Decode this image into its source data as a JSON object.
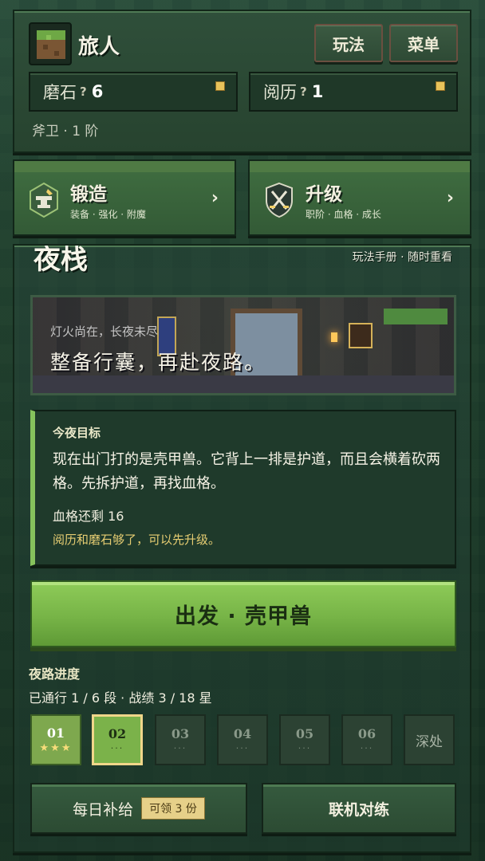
{
  "header": {
    "player_name": "旅人",
    "rules_label": "玩法",
    "menu_label": "菜单",
    "stone": {
      "label": "磨石",
      "hint": "?",
      "value": "6"
    },
    "experience": {
      "label": "阅历",
      "hint": "?",
      "value": "1"
    },
    "rank": "斧卫 · 1 阶"
  },
  "cards": [
    {
      "title": "锻造",
      "subtitle": "装备 · 强化 · 附魔",
      "icon": "anvil-icon"
    },
    {
      "title": "升级",
      "subtitle": "职阶 · 血格 · 成长",
      "icon": "crossed-swords-shield-icon"
    }
  ],
  "main": {
    "title": "夜栈",
    "manual_link": "玩法手册 · 随时重看",
    "banner": {
      "subtitle": "灯火尚在，长夜未尽",
      "headline": "整备行囊，再赴夜路。"
    },
    "objective": {
      "heading": "今夜目标",
      "text": "现在出门打的是壳甲兽。它背上一排是护道，而且会横着砍两格。先拆护道，再找血格。",
      "hp": "血格还剩 16",
      "tip": "阅历和磨石够了，可以先升级。"
    },
    "go_button": "出发 · 壳甲兽",
    "progress": {
      "title": "夜路进度",
      "stats": "已通行 1 / 6 段 · 战绩 3 / 18 星",
      "stages": [
        {
          "num": "01",
          "mark": "★★★",
          "state": "done"
        },
        {
          "num": "02",
          "mark": "···",
          "state": "current"
        },
        {
          "num": "03",
          "mark": "···",
          "state": "locked"
        },
        {
          "num": "04",
          "mark": "···",
          "state": "locked"
        },
        {
          "num": "05",
          "mark": "···",
          "state": "locked"
        },
        {
          "num": "06",
          "mark": "···",
          "state": "locked"
        }
      ],
      "deep_label": "深处"
    },
    "daily_label": "每日补给",
    "daily_badge": "可领 3 份",
    "online_label": "联机对练"
  },
  "colors": {
    "accent_green": "#77b447",
    "gold": "#e8c35a",
    "panel": "#2f4f3a"
  }
}
